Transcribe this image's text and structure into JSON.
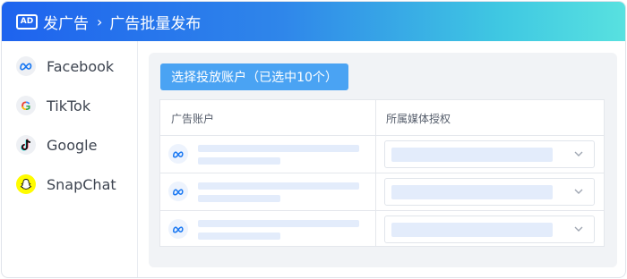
{
  "header": {
    "badge": "AD",
    "crumbs": [
      "发广告",
      "广告批量发布"
    ],
    "separator": "›"
  },
  "sidebar": {
    "items": [
      {
        "label": "Facebook",
        "icon": "meta-icon"
      },
      {
        "label": "TikTok",
        "icon": "google-icon"
      },
      {
        "label": "Google",
        "icon": "tiktok-icon"
      },
      {
        "label": "SnapChat",
        "icon": "snapchat-icon"
      }
    ]
  },
  "main": {
    "select_button": "选择投放账户（已选中10个）",
    "table": {
      "columns": [
        "广告账户",
        "所属媒体授权"
      ],
      "rows": [
        {
          "account_icon": "meta-icon",
          "auth_icon": "chevron-down-icon"
        },
        {
          "account_icon": "meta-icon",
          "auth_icon": "chevron-down-icon"
        },
        {
          "account_icon": "meta-icon",
          "auth_icon": "chevron-down-icon"
        }
      ]
    }
  },
  "colors": {
    "header_gradient_start": "#1e63ee",
    "header_gradient_end": "#58e1e0",
    "primary_button": "#4aa3f3",
    "placeholder_fill": "#e3ecfb",
    "meta_blue": "#1877f2"
  }
}
